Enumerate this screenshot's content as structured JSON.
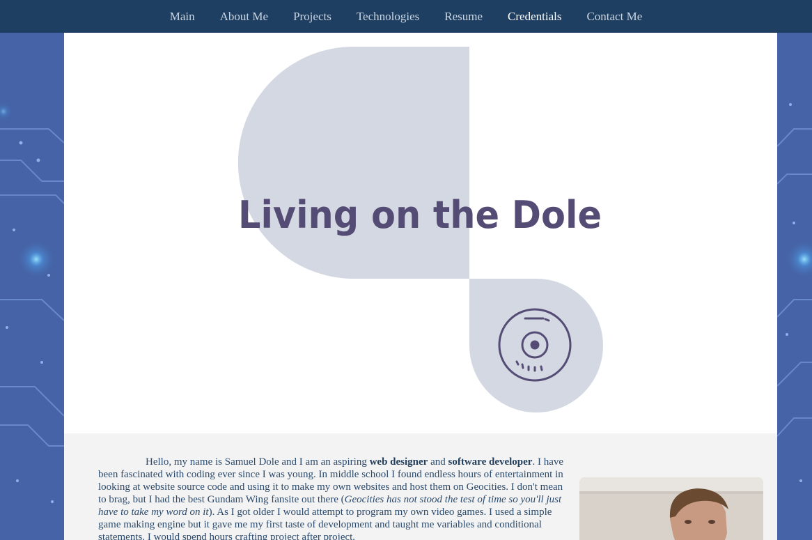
{
  "nav": {
    "items": [
      {
        "label": "Main"
      },
      {
        "label": "About Me"
      },
      {
        "label": "Projects"
      },
      {
        "label": "Technologies"
      },
      {
        "label": "Resume"
      },
      {
        "label": "Credentials"
      },
      {
        "label": "Contact Me"
      }
    ],
    "active": "Credentials"
  },
  "logo": {
    "text": "Living on the Dole",
    "shape_color": "#d3d8e2",
    "text_color": "#544c74"
  },
  "bio": {
    "p1": "Hello, my name is Samuel Dole and I am an aspiring ",
    "b1": "web designer",
    "p2": " and ",
    "b2": "software developer",
    "p3": ". I have been fascinated with coding ever since I was young. In middle school I found endless hours of entertainment in looking at website source code and using it to make my own websites and host them on Geocities. I don't mean to brag, but I had the best Gundam Wing fansite out there (",
    "i1": "Geocities has not stood the test of time so you'll just have to take my word on it",
    "p4": "). As I got older I would attempt to program my own video games. I used a simple game making engine but it gave me my first taste of development and taught me variables and conditional statements. I would spend hours crafting project after project."
  },
  "photo": {
    "icon": "portrait-photo"
  },
  "colors": {
    "nav_bg": "#1f3f62",
    "page_bg": "#4a66a8",
    "content_bg": "#f3f3f3",
    "text": "#2b4a6b"
  }
}
